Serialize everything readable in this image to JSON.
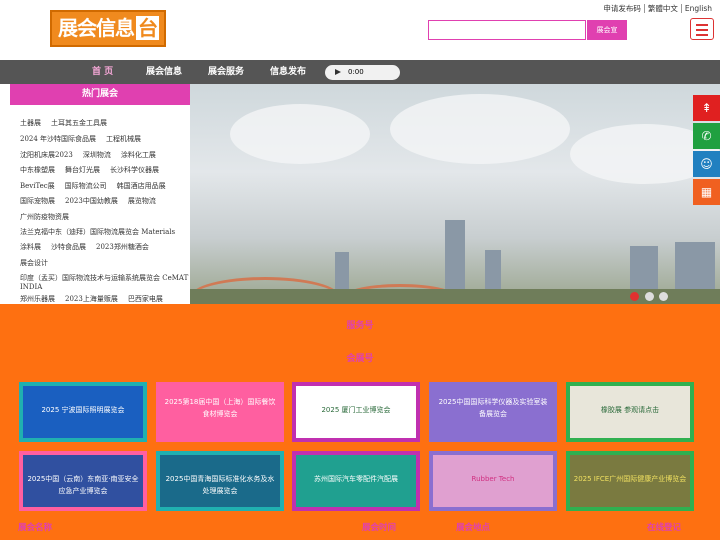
{
  "header": {
    "logo_text": "展会信息",
    "logo_tai": "台",
    "top_links": [
      "申请发布码",
      "繁體中文",
      "English"
    ],
    "search_placeholder": "",
    "search_button": "展会宣"
  },
  "nav": {
    "items": [
      "首 页",
      "展会信息",
      "展会服务",
      "信息发布"
    ]
  },
  "audio": {
    "time": "0:00"
  },
  "hot": {
    "title": "热门展会",
    "rows": [
      [
        "土器展",
        "土耳其五金工具展"
      ],
      [
        "2024 年沙特国际食品展",
        "工程机械展"
      ],
      [
        "沈阳机床展2023",
        "深圳物流",
        "涂料化工展"
      ],
      [
        "中东橡塑展",
        "舞台灯光展",
        "长沙科学仪器展"
      ],
      [
        "BeviTec展",
        "国际物流公司",
        "韩国酒店用品展"
      ],
      [
        "国际宠物展",
        "2023中国幼教展",
        "展览物流"
      ],
      [
        "广州防疫物资展"
      ],
      [
        "法兰克福中东（迪拜）国际物流展览会 Materials"
      ],
      [
        "涂料展",
        "沙特食品展",
        "2023郑州糖酒会"
      ],
      [
        "展会设计"
      ],
      [
        "印度（孟买）国际物流技术与运输系统展览会 CeMAT"
      ],
      [
        "INDIA"
      ],
      [
        "郑州乐器展",
        "2023上海量贩展",
        "巴西家电展"
      ]
    ]
  },
  "sections": {
    "service": "服务号",
    "exhibit": "会展号"
  },
  "cards": [
    {
      "text": "2025 宁波国际照明展览会",
      "bg": "#20b0b0",
      "inner": "#1a5fc0",
      "color": "#fff"
    },
    {
      "text": "2025第18届中国（上海）国际餐饮食材博览会",
      "bg": "#ff5fa0",
      "inner": "#ff5fa0",
      "color": "#fff",
      "plain": true
    },
    {
      "text": "2025 厦门工业博览会",
      "bg": "#c030b0",
      "inner": "#ffffff",
      "color": "#2a6a3a"
    },
    {
      "text": "2025中国国际科学仪器及实验室装备展览会",
      "bg": "#8a6fd0",
      "inner": "#8a6fd0",
      "color": "#fff",
      "plain": true
    },
    {
      "text": "橡胶展 参观请点击",
      "bg": "#30b050",
      "inner": "#e8e6da",
      "color": "#2a6a3a"
    },
    {
      "text": "2025中国（云南）东南亚·南亚安全应急产业博览会",
      "bg": "#ff5fa0",
      "inner": "#3050a0",
      "color": "#fff"
    },
    {
      "text": "2025中国青海国际标准化水务及水处理展览会",
      "bg": "#20b0b0",
      "inner": "#1a6a8a",
      "color": "#fff"
    },
    {
      "text": "苏州国际汽车零配件汽配展",
      "bg": "#c030b0",
      "inner": "#20a090",
      "color": "#fff"
    },
    {
      "text": "Rubber Tech",
      "bg": "#8a6fd0",
      "inner": "#e0a0d0",
      "color": "#d03080"
    },
    {
      "text": "2025 IFCE广州国际健康产业博览会",
      "bg": "#30b050",
      "inner": "#7a7a40",
      "color": "#f0e060"
    }
  ],
  "footer": [
    "展会名称",
    "展会时间",
    "展会地点",
    "在线登记"
  ],
  "side_icons": [
    "top-icon",
    "phone-icon",
    "qq-icon",
    "qrcode-icon"
  ],
  "colors": {
    "accent": "#e040b0",
    "orange": "#fe7011",
    "nav": "#555555"
  }
}
